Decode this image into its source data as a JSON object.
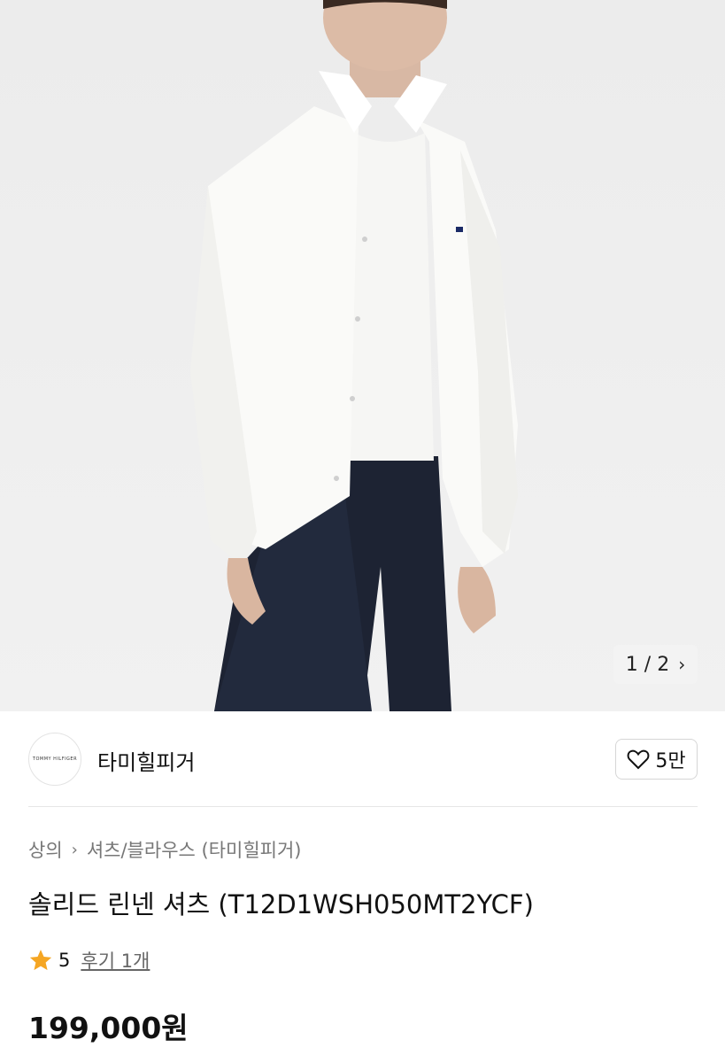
{
  "gallery": {
    "current": "1",
    "separator": "/",
    "total": "2",
    "next_icon": "chevron-right-icon"
  },
  "brand": {
    "logo_text": "TOMMY HILFIGER",
    "name": "타미힐피거",
    "like_icon": "heart-icon",
    "like_count": "5만"
  },
  "breadcrumb": {
    "items": [
      "상의",
      "셔츠/블라우스 (타미힐피거)"
    ],
    "separator_icon": "chevron-right-icon"
  },
  "product": {
    "title": "솔리드 린넨 셔츠 (T12D1WSH050MT2YCF)",
    "rating": "5",
    "rating_icon": "star-icon",
    "review_label": "후기 1개",
    "price": "199,000원"
  },
  "colors": {
    "star": "#F5A623",
    "text": "#111111",
    "muted": "#777777"
  }
}
